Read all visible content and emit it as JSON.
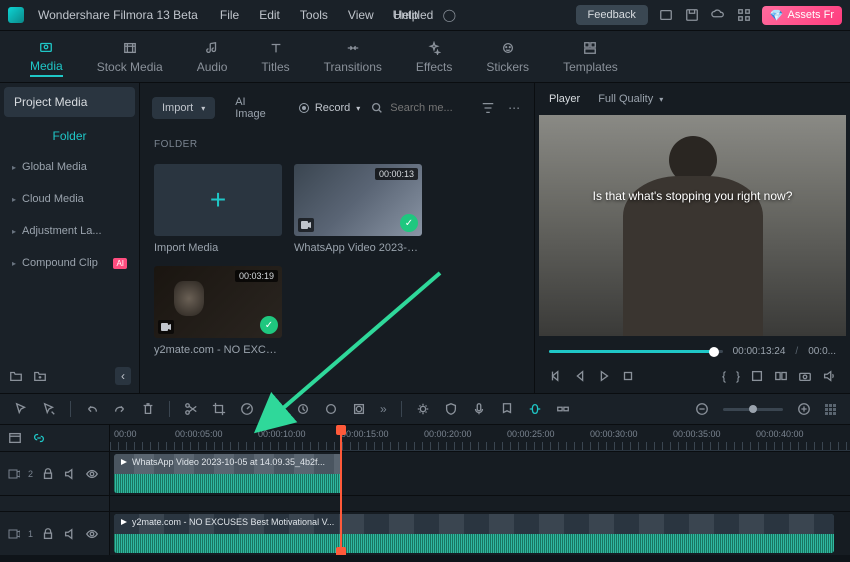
{
  "app": {
    "name": "Wondershare Filmora 13 Beta",
    "title": "Untitled"
  },
  "menu": [
    "File",
    "Edit",
    "Tools",
    "View",
    "Help"
  ],
  "titleRight": {
    "feedback": "Feedback",
    "assets": "Assets Fr"
  },
  "tabs": [
    {
      "label": "Media",
      "active": true
    },
    {
      "label": "Stock Media"
    },
    {
      "label": "Audio"
    },
    {
      "label": "Titles"
    },
    {
      "label": "Transitions"
    },
    {
      "label": "Effects"
    },
    {
      "label": "Stickers"
    },
    {
      "label": "Templates"
    }
  ],
  "sidebar": {
    "header": "Project Media",
    "folder": "Folder",
    "items": [
      {
        "label": "Global Media"
      },
      {
        "label": "Cloud Media"
      },
      {
        "label": "Adjustment La..."
      },
      {
        "label": "Compound Clip",
        "ai": "AI"
      }
    ]
  },
  "contentBar": {
    "import": "Import",
    "aiImage": "AI Image",
    "record": "Record",
    "searchPlaceholder": "Search me..."
  },
  "folderHeader": "FOLDER",
  "media": [
    {
      "name": "Import Media",
      "import": true
    },
    {
      "name": "WhatsApp Video 2023-10-05...",
      "dur": "00:00:13"
    },
    {
      "name": "y2mate.com - NO EXCUSES ...",
      "dur": "00:03:19"
    }
  ],
  "player": {
    "tab": "Player",
    "quality": "Full Quality",
    "subtitle": "Is that what's stopping you right now?",
    "time": "00:00:13:24",
    "total": "00:0..."
  },
  "ruler": [
    "00:00",
    "00:00:05:00",
    "00:00:10:00",
    "00:00:15:00",
    "00:00:20:00",
    "00:00:25:00",
    "00:00:30:00",
    "00:00:35:00",
    "00:00:40:00"
  ],
  "tracks": {
    "t2": {
      "num": "2",
      "clip": "WhatsApp Video 2023-10-05 at 14.09.35_4b2f..."
    },
    "t1": {
      "num": "1",
      "clip": "y2mate.com - NO EXCUSES  Best Motivational V..."
    }
  }
}
